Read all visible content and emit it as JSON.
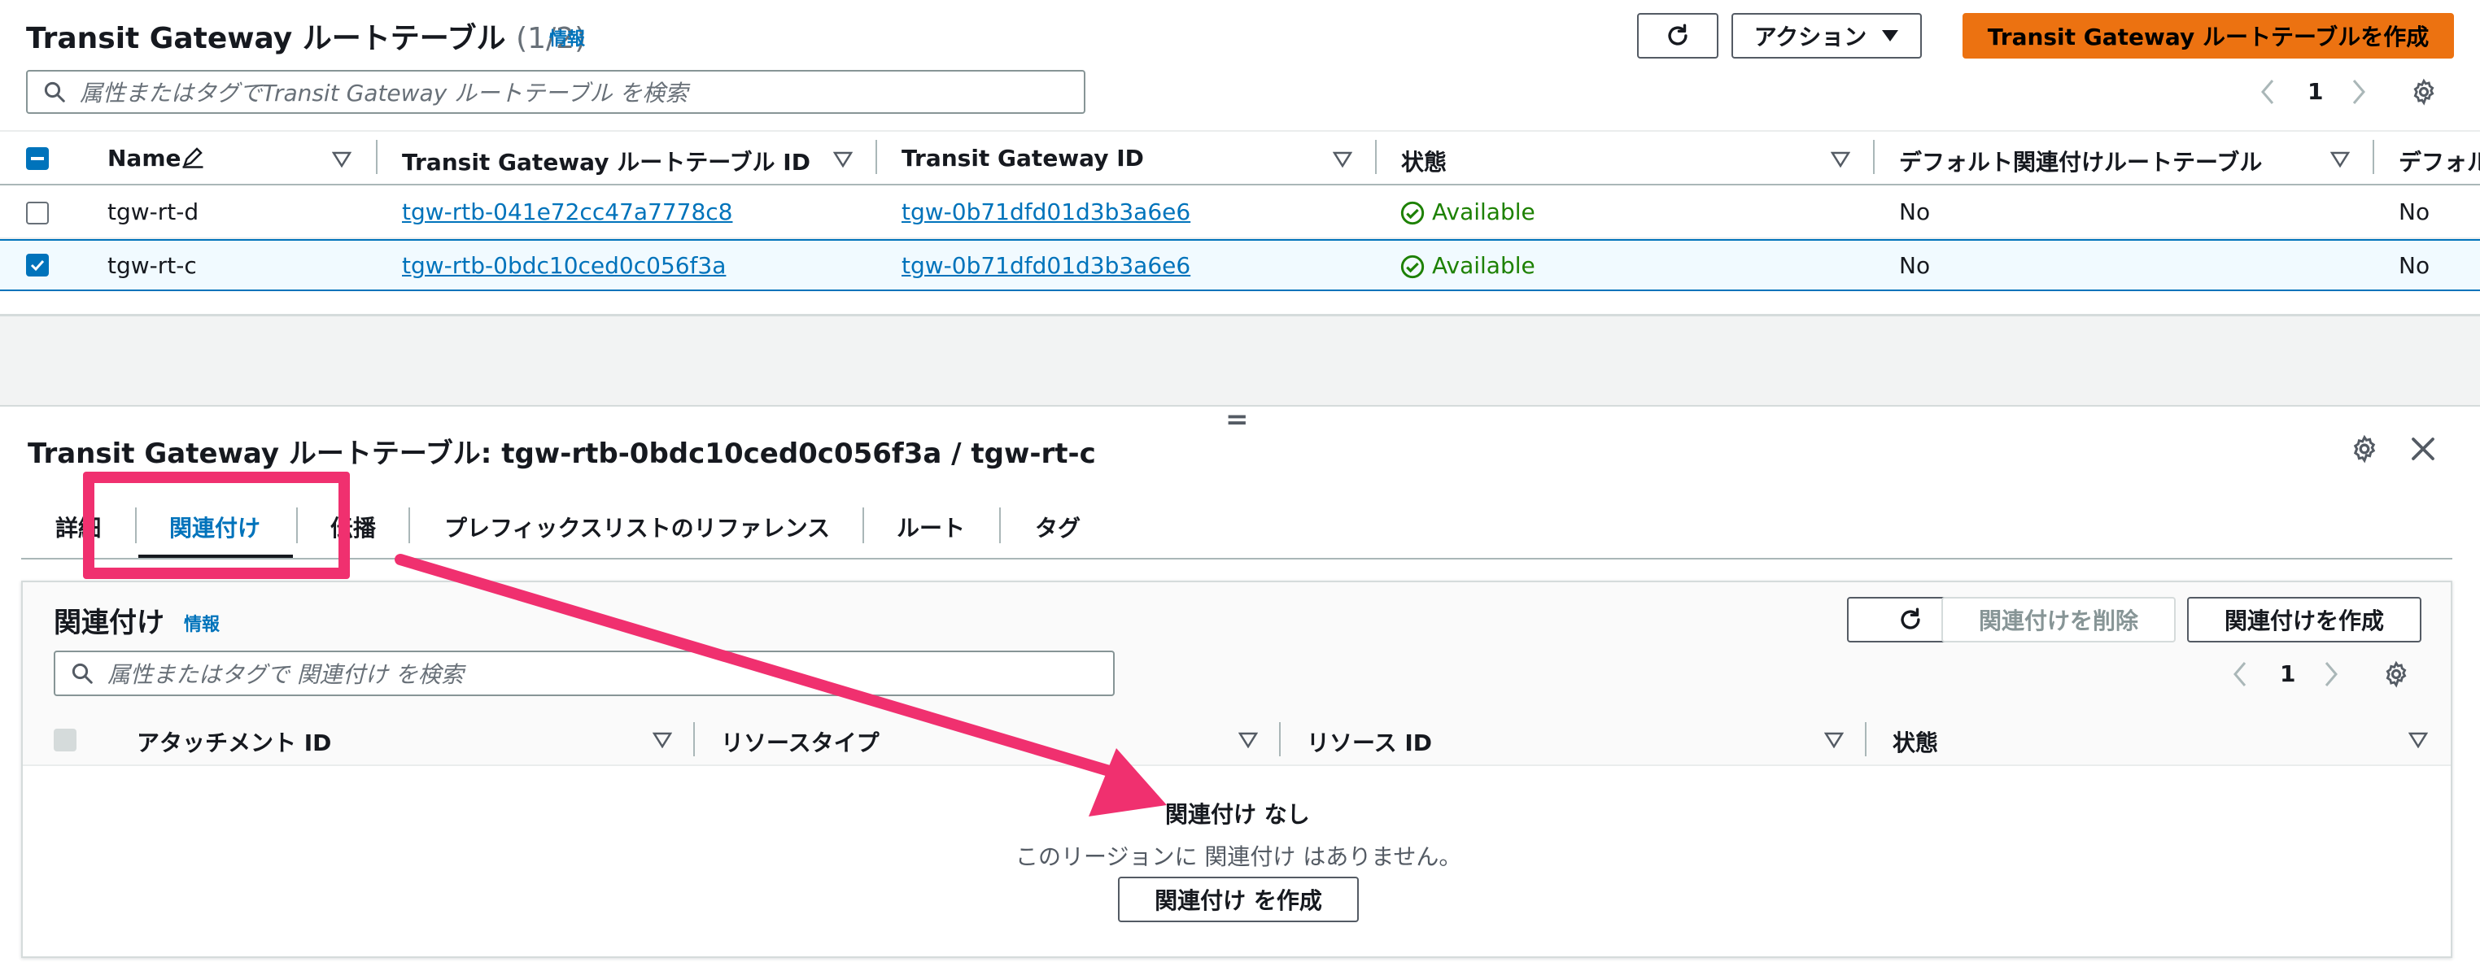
{
  "top": {
    "title": "Transit Gateway ルートテーブル",
    "count": "(1/2)",
    "info": "情報",
    "actions_label": "アクション",
    "create_label": "Transit Gateway ルートテーブルを作成",
    "search_placeholder": "属性またはタグでTransit Gateway ルートテーブル を検索",
    "page": "1",
    "columns": [
      "Name",
      "Transit Gateway ルートテーブル ID",
      "Transit Gateway ID",
      "状態",
      "デフォルト関連付けルートテーブル",
      "デフォル"
    ],
    "rows": [
      {
        "name": "tgw-rt-d",
        "rtb_id": "tgw-rtb-041e72cc47a7778c8",
        "tgw_id": "tgw-0b71dfd01d3b3a6e6",
        "state": "Available",
        "default_assoc": "No",
        "default_prop": "No"
      },
      {
        "name": "tgw-rt-c",
        "rtb_id": "tgw-rtb-0bdc10ced0c056f3a",
        "tgw_id": "tgw-0b71dfd01d3b3a6e6",
        "state": "Available",
        "default_assoc": "No",
        "default_prop": "No"
      }
    ]
  },
  "splitter": "=",
  "detail": {
    "title": "Transit Gateway ルートテーブル: tgw-rtb-0bdc10ced0c056f3a / tgw-rt-c",
    "tabs": [
      "詳細",
      "関連付け",
      "伝播",
      "プレフィックスリストのリファレンス",
      "ルート",
      "タグ"
    ],
    "section_title": "関連付け",
    "section_info": "情報",
    "delete_label": "関連付けを削除",
    "create_label": "関連付けを作成",
    "search_placeholder": "属性またはタグで 関連付け を検索",
    "page": "1",
    "columns": [
      "アタッチメント ID",
      "リソースタイプ",
      "リソース ID",
      "状態"
    ],
    "empty_title": "関連付け なし",
    "empty_message": "このリージョンに 関連付け はありません。",
    "empty_button": "関連付け を作成"
  },
  "colors": {
    "primary": "#ec7211",
    "link": "#0073bb",
    "available": "#1d8102",
    "annotation": "#f0306f"
  }
}
